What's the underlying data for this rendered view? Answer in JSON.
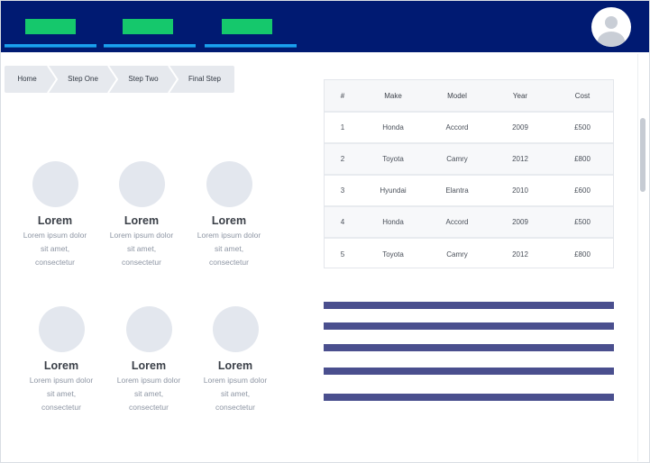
{
  "header": {
    "nav_items": [
      {
        "name": "nav-item-1"
      },
      {
        "name": "nav-item-2"
      },
      {
        "name": "nav-item-3"
      }
    ],
    "colors": {
      "background": "#001a72",
      "pill": "#15c86c",
      "underline": "#1aa1f0"
    },
    "avatar_icon": "user-avatar-icon"
  },
  "breadcrumb": {
    "items": [
      "Home",
      "Step One",
      "Step Two",
      "Final Step"
    ]
  },
  "features": [
    {
      "title": "Lorem",
      "text_lines": [
        "Lorem ipsum dolor",
        "sit amet,",
        "consectetur"
      ]
    },
    {
      "title": "Lorem",
      "text_lines": [
        "Lorem ipsum dolor",
        "sit amet,",
        "consectetur"
      ]
    },
    {
      "title": "Lorem",
      "text_lines": [
        "Lorem ipsum dolor",
        "sit amet,",
        "consectetur"
      ]
    },
    {
      "title": "Lorem",
      "text_lines": [
        "Lorem ipsum dolor",
        "sit amet,",
        "consectetur"
      ]
    },
    {
      "title": "Lorem",
      "text_lines": [
        "Lorem ipsum dolor",
        "sit amet,",
        "consectetur"
      ]
    },
    {
      "title": "Lorem",
      "text_lines": [
        "Lorem ipsum dolor",
        "sit amet,",
        "consectetur"
      ]
    }
  ],
  "table": {
    "headers": [
      "#",
      "Make",
      "Model",
      "Year",
      "Cost"
    ],
    "rows": [
      [
        "1",
        "Honda",
        "Accord",
        "2009",
        "£500"
      ],
      [
        "2",
        "Toyota",
        "Camry",
        "2012",
        "£800"
      ],
      [
        "3",
        "Hyundai",
        "Elantra",
        "2010",
        "£600"
      ],
      [
        "4",
        "Honda",
        "Accord",
        "2009",
        "£500"
      ],
      [
        "5",
        "Toyota",
        "Camry",
        "2012",
        "£800"
      ]
    ]
  },
  "lines": {
    "count": 5,
    "color": "#4a4f8e"
  }
}
